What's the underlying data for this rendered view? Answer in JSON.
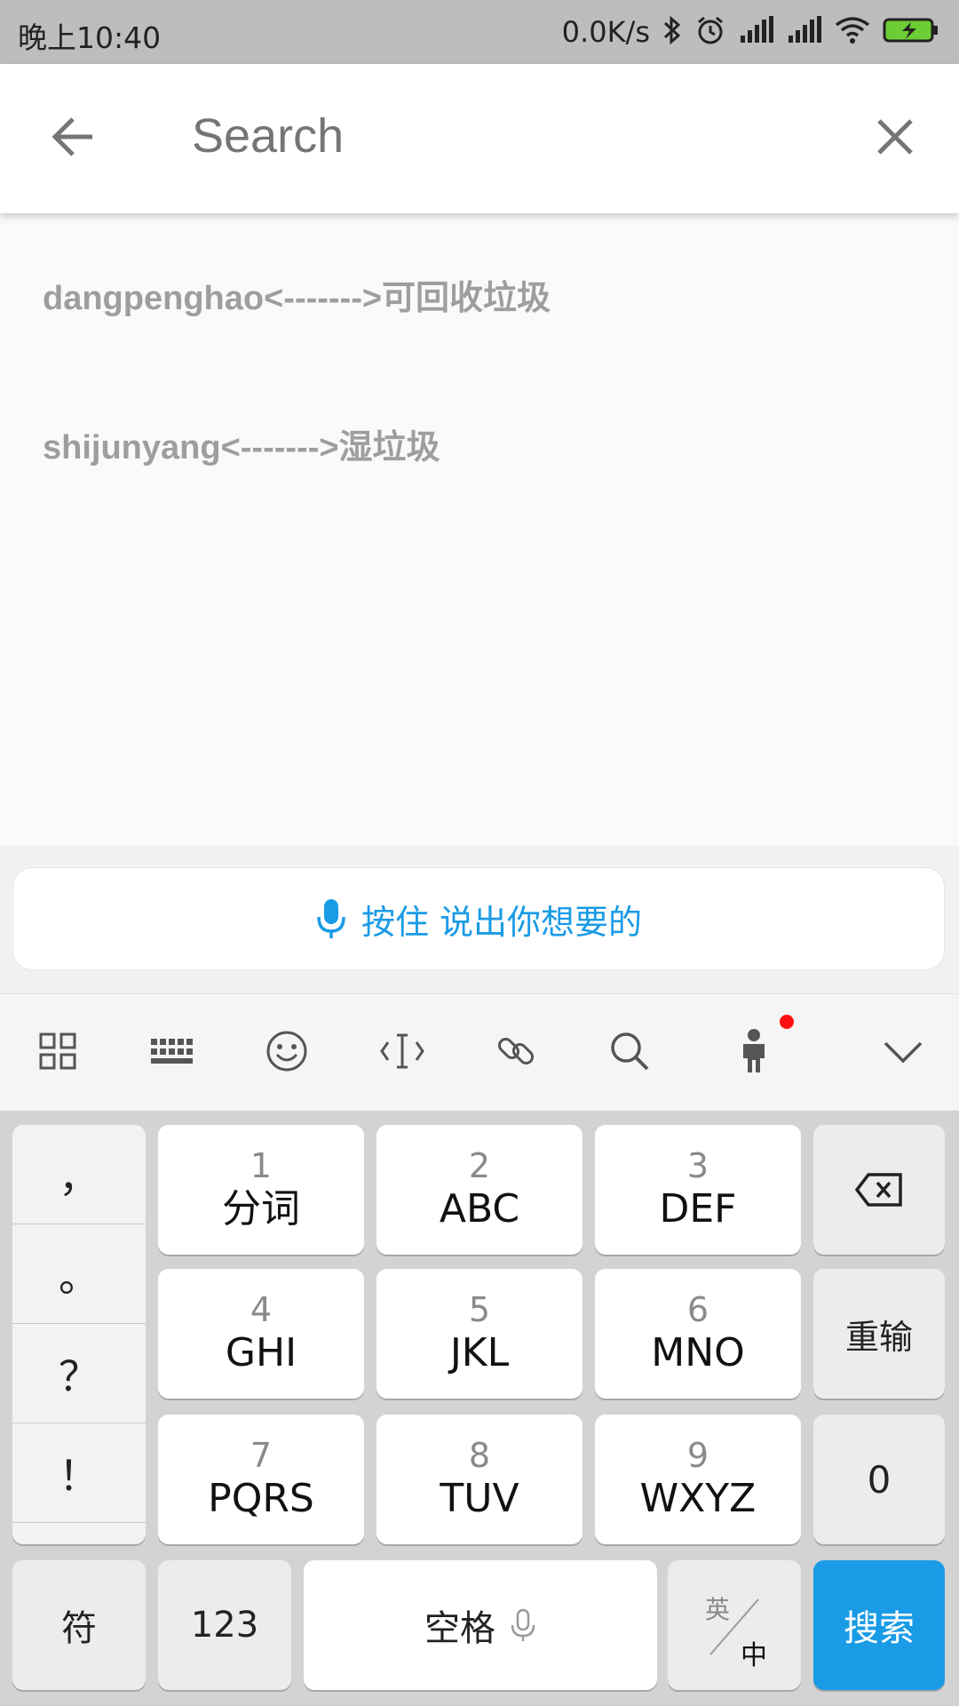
{
  "status_bar": {
    "time": "晚上10:40",
    "net_speed": "0.0K/s",
    "icons": [
      "bluetooth-icon",
      "alarm-icon",
      "signal-icon",
      "signal-icon",
      "wifi-icon",
      "battery-charging-icon"
    ]
  },
  "app_bar": {
    "search_placeholder": "Search",
    "back_icon": "arrow-left-icon",
    "clear_icon": "close-icon"
  },
  "results": [
    "dangpenghao<------->可回收垃圾",
    "shijunyang<------->湿垃圾"
  ],
  "keyboard": {
    "voice_label": "按住 说出你想要的",
    "toolbar_icons": [
      "grid-icon",
      "keyboard-icon",
      "emoji-icon",
      "text-cursor-icon",
      "link-icon",
      "search-icon",
      "avatar-icon",
      "collapse-chevron-icon"
    ],
    "punctuation": [
      "，",
      "。",
      "？",
      "！"
    ],
    "keys": [
      {
        "num": "1",
        "letters": "分词"
      },
      {
        "num": "2",
        "letters": "ABC"
      },
      {
        "num": "3",
        "letters": "DEF"
      },
      {
        "num": "4",
        "letters": "GHI"
      },
      {
        "num": "5",
        "letters": "JKL"
      },
      {
        "num": "6",
        "letters": "MNO"
      },
      {
        "num": "7",
        "letters": "PQRS"
      },
      {
        "num": "8",
        "letters": "TUV"
      },
      {
        "num": "9",
        "letters": "WXYZ"
      }
    ],
    "reenter": "重输",
    "zero": "0",
    "symbols": "符",
    "numbers": "123",
    "space": "空格",
    "lang_en": "英",
    "lang_zh": "中",
    "search": "搜索",
    "colors": {
      "accent": "#1a9be6",
      "key_bg": "#ffffff",
      "board_bg": "#d3d3d3"
    }
  }
}
